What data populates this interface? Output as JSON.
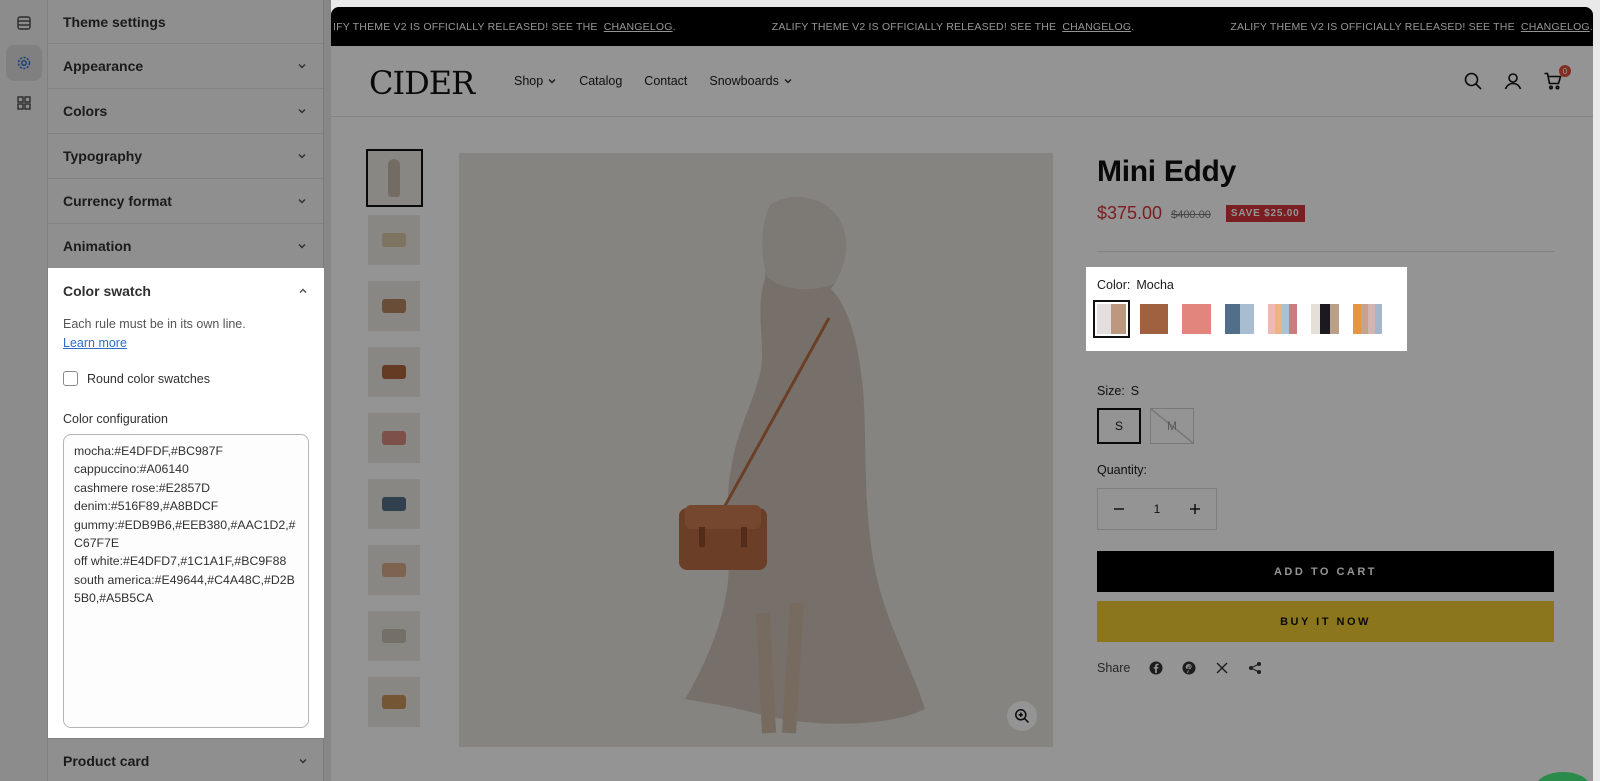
{
  "sidebar": {
    "title": "Theme settings",
    "sections": [
      {
        "label": "Appearance"
      },
      {
        "label": "Colors"
      },
      {
        "label": "Typography"
      },
      {
        "label": "Currency format"
      },
      {
        "label": "Animation"
      }
    ],
    "color_swatch": {
      "label": "Color swatch",
      "help": "Each rule must be in its own line.",
      "learn_more": "Learn more",
      "round_label": "Round color swatches",
      "config_label": "Color configuration",
      "config_value": "mocha:#E4DFDF,#BC987F\ncappuccino:#A06140\ncashmere rose:#E2857D\ndenim:#516F89,#A8BDCF\ngummy:#EDB9B6,#EEB380,#AAC1D2,#C67F7E\noff white:#E4DFD7,#1C1A1F,#BC9F88\nsouth america:#E49644,#C4A48C,#D2B5B0,#A5B5CA"
    },
    "bottom_section": "Product card"
  },
  "announcement": {
    "text": "ZALIFY THEME V2 IS OFFICIALLY RELEASED! SEE THE",
    "link": "CHANGELOG",
    "suffix": ".",
    "partial": "IFY THEME V2 IS OFFICIALLY RELEASED! SEE THE"
  },
  "header": {
    "logo": "CIDER",
    "nav": {
      "shop": "Shop",
      "catalog": "Catalog",
      "contact": "Contact",
      "snowboards": "Snowboards"
    },
    "cart_count": "0"
  },
  "product": {
    "title": "Mini Eddy",
    "price": "$375.00",
    "compare_price": "$400.00",
    "save_badge": "SAVE $25.00",
    "color_label": "Color:",
    "color_value": "Mocha",
    "swatches": [
      {
        "name": "mocha",
        "colors": [
          "#E4DFDF",
          "#BC987F"
        ]
      },
      {
        "name": "cappuccino",
        "colors": [
          "#A06140"
        ]
      },
      {
        "name": "cashmere rose",
        "colors": [
          "#E2857D"
        ]
      },
      {
        "name": "denim",
        "colors": [
          "#516F89",
          "#A8BDCF"
        ]
      },
      {
        "name": "gummy",
        "colors": [
          "#EDB9B6",
          "#EEB380",
          "#AAC1D2",
          "#C67F7E"
        ]
      },
      {
        "name": "off white",
        "colors": [
          "#E4DFD7",
          "#1C1A1F",
          "#BC9F88"
        ]
      },
      {
        "name": "south america",
        "colors": [
          "#E49644",
          "#C4A48C",
          "#D2B5B0",
          "#A5B5CA"
        ]
      }
    ],
    "size_label": "Size:",
    "size_value": "S",
    "sizes": [
      "S",
      "M"
    ],
    "quantity_label": "Quantity:",
    "quantity": "1",
    "add_to_cart": "ADD TO CART",
    "buy_now": "BUY IT NOW",
    "share_label": "Share"
  },
  "colors": {
    "sale_red": "#D2343A",
    "buy_button": "#F1CC32",
    "link_blue": "#2C6ECB"
  }
}
